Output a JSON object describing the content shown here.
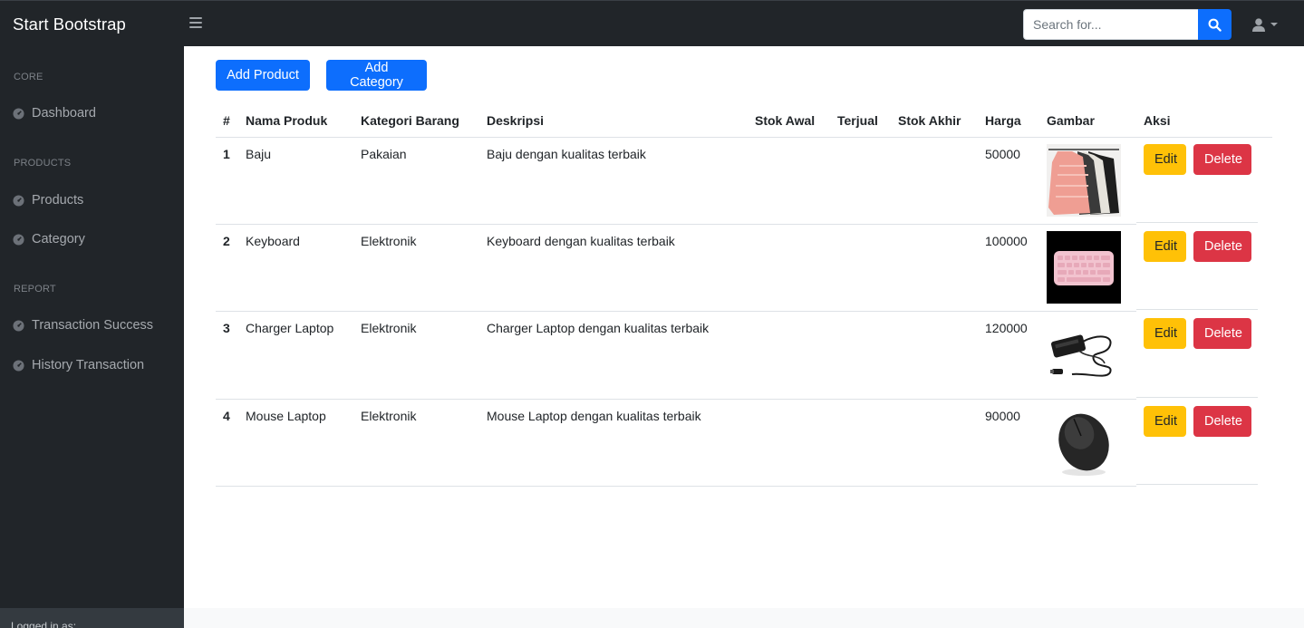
{
  "navbar": {
    "brand": "Start Bootstrap",
    "search_placeholder": "Search for..."
  },
  "sidebar": {
    "sections": [
      {
        "heading": "Core",
        "items": [
          {
            "label": "Dashboard"
          }
        ]
      },
      {
        "heading": "Products",
        "items": [
          {
            "label": "Products"
          },
          {
            "label": "Category"
          }
        ]
      },
      {
        "heading": "Report",
        "items": [
          {
            "label": "Transaction Success"
          },
          {
            "label": "History Transaction"
          }
        ]
      }
    ],
    "footer": "Logged in as:"
  },
  "actions": {
    "add_product": "Add Product",
    "add_category": "Add Category"
  },
  "table": {
    "headers": [
      "#",
      "Nama Produk",
      "Kategori Barang",
      "Deskripsi",
      "Stok Awal",
      "Terjual",
      "Stok Akhir",
      "Harga",
      "Gambar",
      "Aksi"
    ],
    "rows": [
      {
        "no": "1",
        "nama": "Baju",
        "kategori": "Pakaian",
        "deskripsi": "Baju dengan kualitas terbaik",
        "stok_awal": "",
        "terjual": "",
        "stok_akhir": "",
        "harga": "50000",
        "image": "clothes-image"
      },
      {
        "no": "2",
        "nama": "Keyboard",
        "kategori": "Elektronik",
        "deskripsi": "Keyboard dengan kualitas terbaik",
        "stok_awal": "",
        "terjual": "",
        "stok_akhir": "",
        "harga": "100000",
        "image": "keyboard-image"
      },
      {
        "no": "3",
        "nama": "Charger Laptop",
        "kategori": "Elektronik",
        "deskripsi": "Charger Laptop dengan kualitas terbaik",
        "stok_awal": "",
        "terjual": "",
        "stok_akhir": "",
        "harga": "120000",
        "image": "charger-image"
      },
      {
        "no": "4",
        "nama": "Mouse Laptop",
        "kategori": "Elektronik",
        "deskripsi": "Mouse Laptop dengan kualitas terbaik",
        "stok_awal": "",
        "terjual": "",
        "stok_akhir": "",
        "harga": "90000",
        "image": "mouse-image"
      }
    ],
    "edit_label": "Edit",
    "delete_label": "Delete"
  },
  "colors": {
    "dark": "#212529",
    "primary": "#0d6efd",
    "warning": "#ffc107",
    "danger": "#dc3545"
  }
}
